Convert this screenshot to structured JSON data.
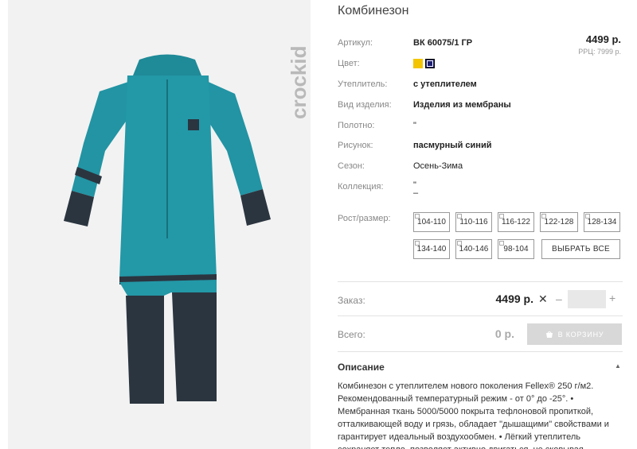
{
  "product": {
    "title": "Комбинезон",
    "price": "4499 р.",
    "rrp": "РРЦ: 7999 р.",
    "brand": "crockid"
  },
  "specs": {
    "article_label": "Артикул:",
    "article_value": "ВК 60075/1 ГР",
    "color_label": "Цвет:",
    "colors": [
      "#f2c500",
      "#1c1f6e"
    ],
    "insulation_label": "Утеплитель:",
    "insulation_value": "с утеплителем",
    "type_label": "Вид изделия:",
    "type_value": "Изделия из мембраны",
    "fabric_label": "Полотно:",
    "fabric_value": "\"",
    "pattern_label": "Рисунок:",
    "pattern_value": "пасмурный синий",
    "season_label": "Сезон:",
    "season_value": "Осень-Зима",
    "collection_label": "Коллекция:",
    "collection_value_1": "\"",
    "collection_value_2": "–"
  },
  "sizes": {
    "label": "Рост/размер:",
    "options": [
      "104-110",
      "110-116",
      "116-122",
      "122-128",
      "128-134",
      "134-140",
      "140-146",
      "98-104"
    ],
    "select_all": "ВЫБРАТЬ ВСЕ"
  },
  "order": {
    "label": "Заказ:",
    "price": "4499 р.",
    "times": "✕",
    "minus": "–",
    "plus": "+",
    "quantity": ""
  },
  "total": {
    "label": "Всего:",
    "value": "0 р.",
    "cart_button": "В КОРЗИНУ"
  },
  "description": {
    "title": "Описание",
    "text": "Комбинезон с утеплителем нового поколения Fellex® 250 г/м2. Рекомендованный температурный режим - от 0° до -25°. • Мембранная ткань 5000/5000 покрыта тефлоновой пропиткой, отталкивающей воду и грязь, обладает \"дышащими\" свойствами и гарантирует идеальный воздухообмен. • Лёгкий утеплитель сохраняет тепло, позволяет активно двигаться, не сковывая"
  }
}
